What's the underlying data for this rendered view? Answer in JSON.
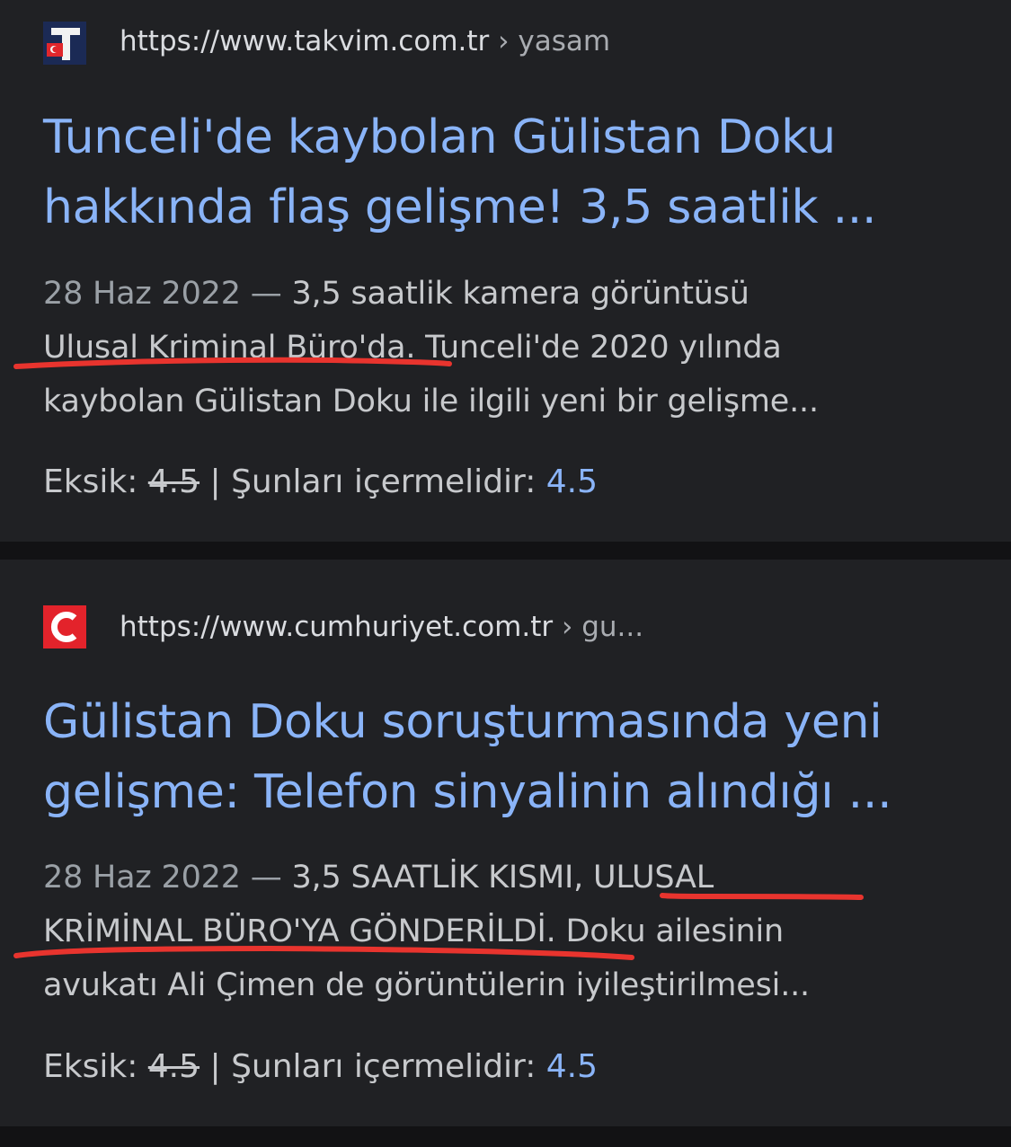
{
  "results": [
    {
      "favicon": {
        "icon": "takvim-logo-icon",
        "letter": "T",
        "bg": "#1b2a55",
        "accent": "#e0262c"
      },
      "source": {
        "url": "https://www.takvim.com.tr",
        "path": " › yasam"
      },
      "title": {
        "line1": "Tunceli'de kaybolan Gülistan Doku",
        "line2": "hakkında flaş gelişme! 3,5 saatlik ..."
      },
      "snippet": {
        "date": "28 Haz 2022 — ",
        "line1": "3,5 saatlik kamera görüntüsü",
        "line2": "Ulusal Kriminal Büro'da. Tunceli'de 2020 yılında",
        "line3": "kaybolan Gülistan Doku ile ilgili yeni bir gelişme..."
      },
      "missing": {
        "label": "Eksik: ",
        "struck": "4.5",
        "separator": " | Şunları içermelidir: ",
        "term": "4.5"
      }
    },
    {
      "favicon": {
        "icon": "cumhuriyet-logo-icon",
        "letter": "C",
        "bg": "#e3232b",
        "accent": "#ffffff"
      },
      "source": {
        "url": "https://www.cumhuriyet.com.tr",
        "path": " › gu..."
      },
      "title": {
        "line1": "Gülistan Doku soruşturmasında yeni",
        "line2": "gelişme: Telefon sinyalinin alındığı ..."
      },
      "snippet": {
        "date": "28 Haz 2022 — ",
        "line1": "3,5 SAATLİK KISMI, ULUSAL",
        "line2": "KRİMİNAL BÜRO'YA GÖNDERİLDİ. Doku ailesinin",
        "line3": "avukatı Ali Çimen de görüntülerin iyileştirilmesi..."
      },
      "missing": {
        "label": "Eksik: ",
        "struck": "4.5",
        "separator": " | Şunları içermelidir: ",
        "term": "4.5"
      }
    }
  ],
  "annotation_color": "#e8342e"
}
